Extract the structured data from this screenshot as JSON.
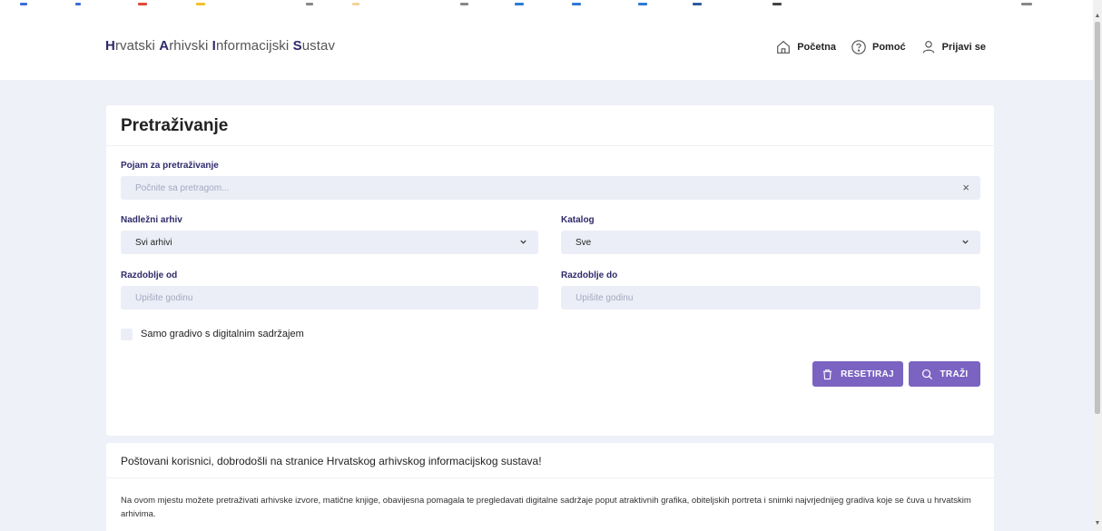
{
  "header": {
    "logo": [
      {
        "initial": "H",
        "rest": "rvatski "
      },
      {
        "initial": "A",
        "rest": "rhivski "
      },
      {
        "initial": "I",
        "rest": "nformacijski "
      },
      {
        "initial": "S",
        "rest": "ustav"
      }
    ],
    "nav": {
      "home": "Početna",
      "help": "Pomoć",
      "login": "Prijavi se"
    }
  },
  "search": {
    "title": "Pretraživanje",
    "term_label": "Pojam za pretraživanje",
    "term_placeholder": "Počnite sa pretragom...",
    "clear_symbol": "×",
    "archive_label": "Nadležni arhiv",
    "archive_value": "Svi arhivi",
    "catalog_label": "Katalog",
    "catalog_value": "Sve",
    "period_from_label": "Razdoblje od",
    "period_from_placeholder": "Upišite godinu",
    "period_to_label": "Razdoblje do",
    "period_to_placeholder": "Upišite godinu",
    "digital_only_label": "Samo gradivo s digitalnim sadržajem",
    "reset_label": "RESETIRAJ",
    "search_label": "TRAŽI"
  },
  "welcome": {
    "title": "Poštovani korisnici, dobrodošli na stranice Hrvatskog arhivskog informacijskog sustava!",
    "text": "Na ovom mjestu možete pretraživati arhivske izvore, matične knjige, obavijesna pomagala te pregledavati digitalne sadržaje poput atraktivnih grafika, obiteljskih portreta i snimki najvrjednijeg gradiva koje se čuva u hrvatskim arhivima."
  },
  "colors": {
    "accent": "#7b63c2",
    "brand": "#2e2a6b",
    "background": "#eef1f8",
    "field": "#eceef7"
  },
  "icons": {
    "home": "home-icon",
    "help": "help-circle-icon",
    "login": "user-icon",
    "clear": "close-icon",
    "dropdown": "chevron-down-icon",
    "reset": "trash-icon",
    "search": "search-icon"
  }
}
